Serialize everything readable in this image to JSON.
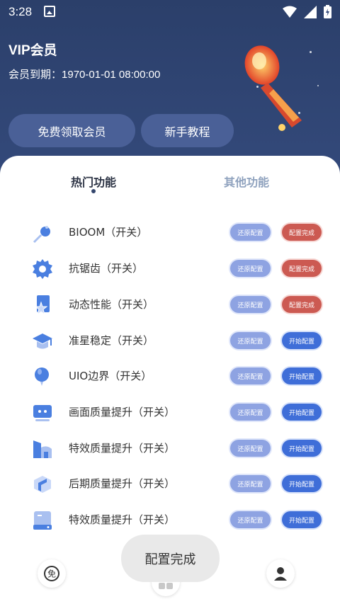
{
  "status_bar": {
    "time": "3:28"
  },
  "header": {
    "title": "VIP会员",
    "expire_label": "会员到期：",
    "expire_value": "1970-01-01 08:00:00",
    "buttons": {
      "free_vip": "免费领取会员",
      "tutorial": "新手教程"
    }
  },
  "tabs": [
    {
      "label": "热门功能",
      "active": true
    },
    {
      "label": "其他功能",
      "active": false
    }
  ],
  "features": [
    {
      "label": "BIOOM（开关）",
      "icon": "toggle-knob-icon",
      "restore": "还原配置",
      "action": "配置完成",
      "state": "done"
    },
    {
      "label": "抗锯齿（开关）",
      "icon": "gear-icon",
      "restore": "还原配置",
      "action": "配置完成",
      "state": "done"
    },
    {
      "label": "动态性能（开关）",
      "icon": "star-bookmark-icon",
      "restore": "还原配置",
      "action": "配置完成",
      "state": "done"
    },
    {
      "label": "准星稳定（开关）",
      "icon": "graduation-cap-icon",
      "restore": "还原配置",
      "action": "开始配置",
      "state": "start"
    },
    {
      "label": "UIO边界（开关）",
      "icon": "balloon-icon",
      "restore": "还原配置",
      "action": "开始配置",
      "state": "start"
    },
    {
      "label": "画面质量提升（开关）",
      "icon": "monitor-icon",
      "restore": "还原配置",
      "action": "开始配置",
      "state": "start"
    },
    {
      "label": "特效质量提升（开关）",
      "icon": "building-icon",
      "restore": "还原配置",
      "action": "开始配置",
      "state": "start"
    },
    {
      "label": "后期质量提升（开关）",
      "icon": "cube-icon",
      "restore": "还原配置",
      "action": "开始配置",
      "state": "start"
    },
    {
      "label": "特效质量提升（开关）",
      "icon": "device-icon",
      "restore": "还原配置",
      "action": "开始配置",
      "state": "start"
    }
  ],
  "bottom_nav": {
    "free_icon_text": "免"
  },
  "toast": "配置完成",
  "colors": {
    "header_bg": "#2f4470",
    "restore": "#8ea3e2",
    "done": "#cc5a52",
    "start": "#3f6ed8",
    "icon_blue": "#4a7fe0"
  }
}
